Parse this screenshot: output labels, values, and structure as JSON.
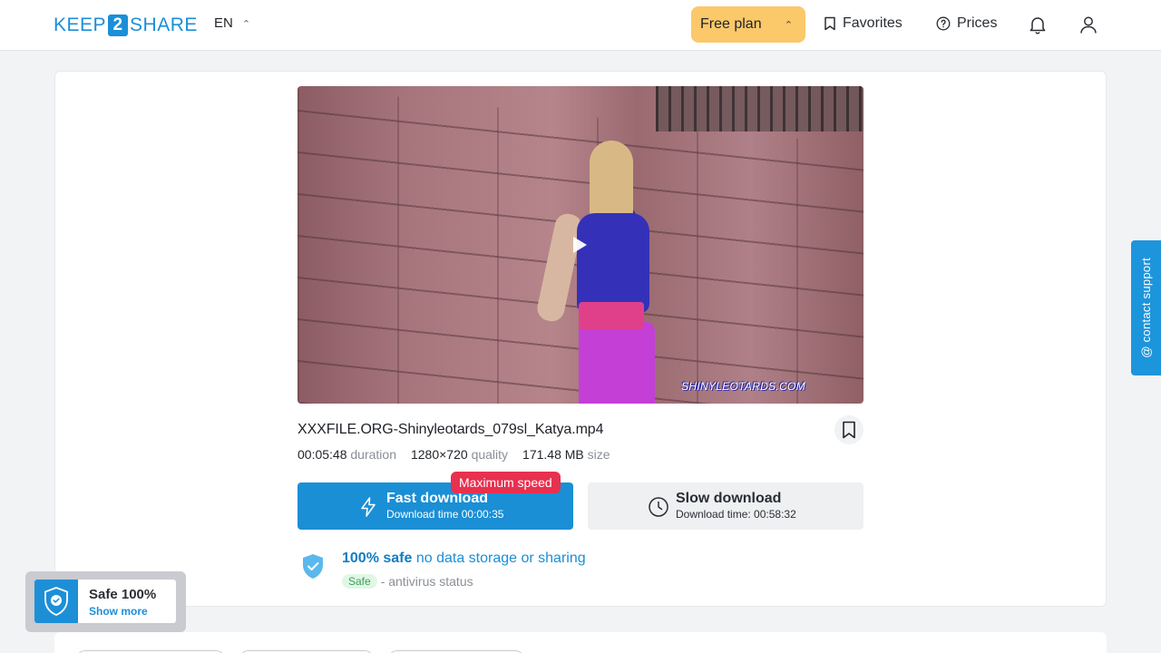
{
  "header": {
    "logo_left": "KEEP",
    "logo_mid": "2",
    "logo_right": "SHARE",
    "language": "EN",
    "plan": "Free plan",
    "favorites": "Favorites",
    "prices": "Prices"
  },
  "file": {
    "name": "XXXFILE.ORG-Shinyleotards_079sl_Katya.mp4",
    "duration": "00:05:48",
    "duration_label": "duration",
    "quality": "1280×720",
    "quality_label": "quality",
    "size": "171.48 MB",
    "size_label": "size",
    "watermark": "SHINYLEOTARDS.COM"
  },
  "download": {
    "badge": "Maximum speed",
    "fast_title": "Fast download",
    "fast_sub": "Download time 00:00:35",
    "slow_title": "Slow download",
    "slow_sub": "Download time: 00:58:32"
  },
  "safety": {
    "safe_bold": "100% safe",
    "safe_rest": "no data storage or sharing",
    "status_pill": "Safe",
    "status_text": "- antivirus status"
  },
  "support": {
    "label": "@ contact support"
  },
  "widget": {
    "title": "Safe 100%",
    "link": "Show more"
  },
  "colors": {
    "accent": "#1a8fd5",
    "plan_bg": "#fbc86a",
    "badge": "#e8304f",
    "safe_green": "#38a15a"
  }
}
